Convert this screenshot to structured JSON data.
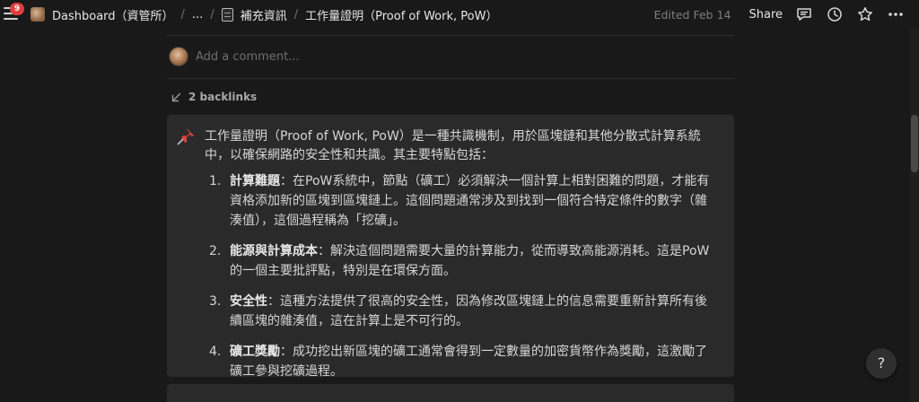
{
  "topbar": {
    "notification_count": "9",
    "breadcrumbs": [
      "Dashboard（資管所）",
      "...",
      "補充資訊",
      "工作量證明（Proof of Work, PoW）"
    ],
    "separator": "/",
    "edited": "Edited Feb 14",
    "share_label": "Share"
  },
  "comment": {
    "placeholder": "Add a comment..."
  },
  "backlinks": {
    "label": "2 backlinks"
  },
  "callout": {
    "icon": "pushpin-icon",
    "intro": "工作量證明（Proof of Work, PoW）是一種共識機制，用於區塊鏈和其他分散式計算系統中，以確保網路的安全性和共識。其主要特點包括：",
    "points": [
      {
        "num": "1.",
        "term": "計算難題",
        "text": "：在PoW系統中，節點（礦工）必須解決一個計算上相對困難的問題，才能有資格添加新的區塊到區塊鏈上。這個問題通常涉及到找到一個符合特定條件的數字（雜湊值），這個過程稱為「挖礦」。"
      },
      {
        "num": "2.",
        "term": "能源與計算成本",
        "text": "：解決這個問題需要大量的計算能力，從而導致高能源消耗。這是PoW的一個主要批評點，特別是在環保方面。"
      },
      {
        "num": "3.",
        "term": "安全性",
        "text": "：這種方法提供了很高的安全性，因為修改區塊鏈上的信息需要重新計算所有後續區塊的雜湊值，這在計算上是不可行的。"
      },
      {
        "num": "4.",
        "term": "礦工獎勵",
        "text": "：成功挖出新區塊的礦工通常會得到一定數量的加密貨幣作為獎勵，這激勵了礦工參與挖礦過程。"
      }
    ]
  },
  "help": {
    "label": "?"
  },
  "colors": {
    "background": "#191919",
    "callout_bg": "#2a2a2a",
    "badge": "#e03e3e",
    "pin": "#e03e3e"
  }
}
